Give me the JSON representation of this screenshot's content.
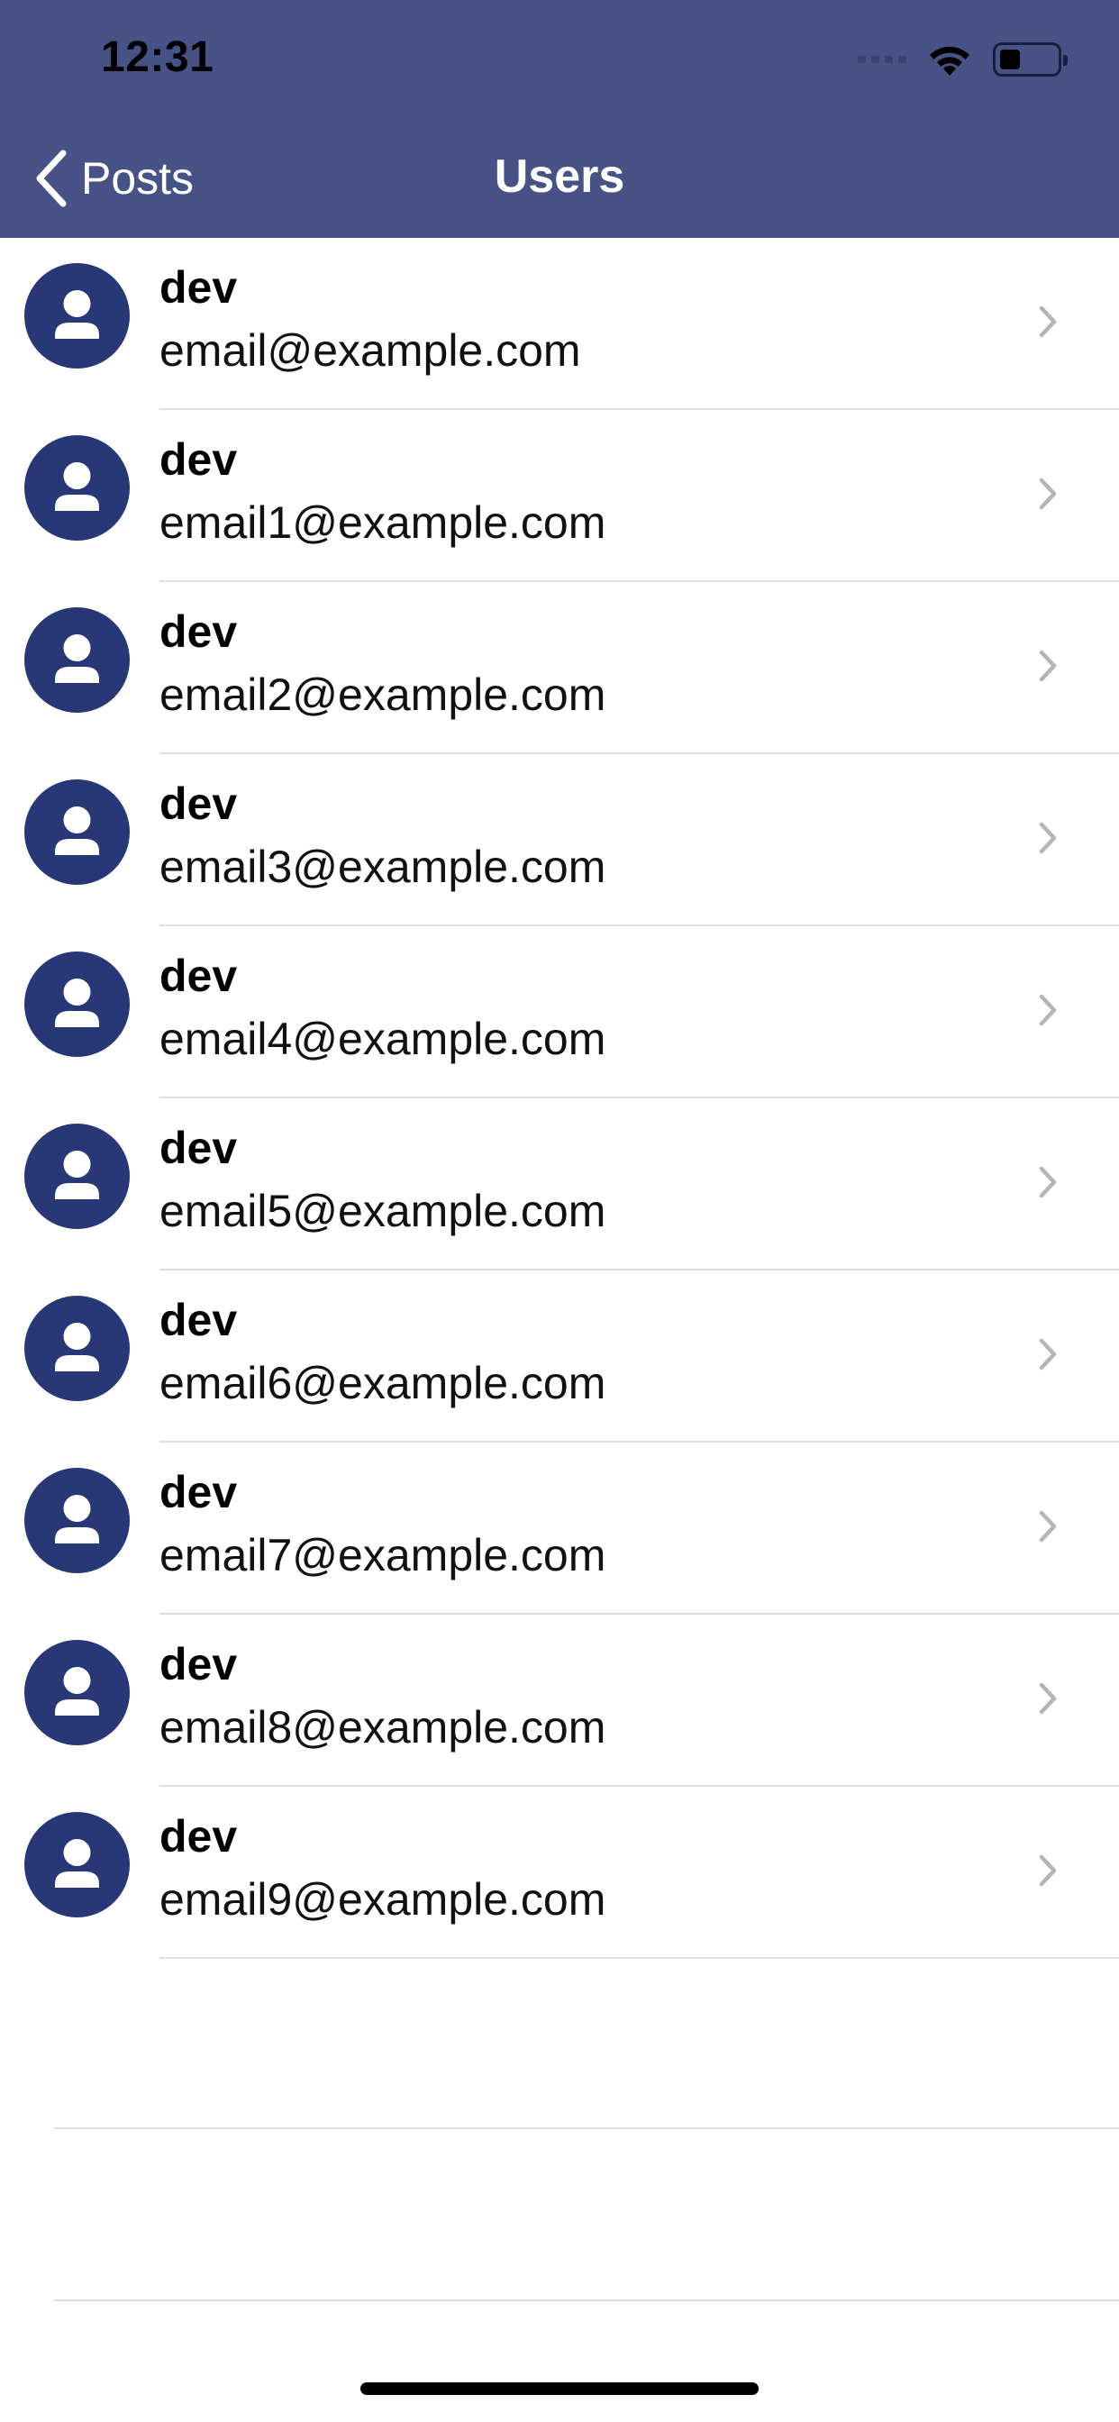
{
  "status_bar": {
    "time": "12:31"
  },
  "nav": {
    "back_label": "Posts",
    "title": "Users"
  },
  "users": [
    {
      "name": "dev",
      "email": "email@example.com"
    },
    {
      "name": "dev",
      "email": "email1@example.com"
    },
    {
      "name": "dev",
      "email": "email2@example.com"
    },
    {
      "name": "dev",
      "email": "email3@example.com"
    },
    {
      "name": "dev",
      "email": "email4@example.com"
    },
    {
      "name": "dev",
      "email": "email5@example.com"
    },
    {
      "name": "dev",
      "email": "email6@example.com"
    },
    {
      "name": "dev",
      "email": "email7@example.com"
    },
    {
      "name": "dev",
      "email": "email8@example.com"
    },
    {
      "name": "dev",
      "email": "email9@example.com"
    }
  ],
  "colors": {
    "header_bg": "#475286",
    "avatar_bg": "#283775",
    "chevron": "#b5b5b5",
    "divider": "#dddddd"
  },
  "icons": {
    "back": "chevron-left-icon",
    "avatar": "person-icon",
    "row_disclosure": "chevron-right-icon",
    "wifi": "wifi-icon",
    "battery": "battery-icon",
    "signal": "cellular-signal-icon"
  }
}
